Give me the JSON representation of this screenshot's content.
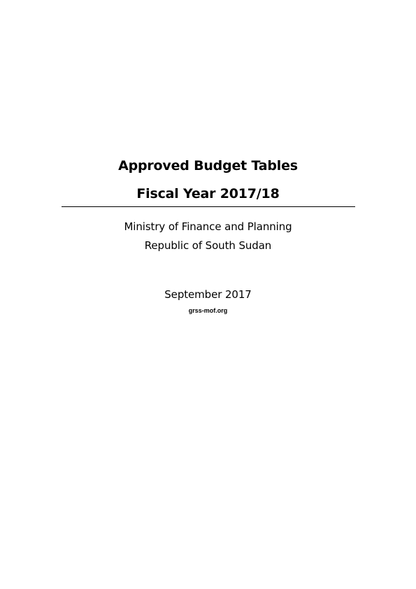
{
  "cover": {
    "title_line_1": "Approved Budget Tables",
    "title_line_2": "Fiscal Year 2017/18",
    "ministry": "Ministry of Finance and Planning",
    "country": "Republic of South Sudan",
    "date": "September 2017",
    "website": "grss-mof.org"
  }
}
